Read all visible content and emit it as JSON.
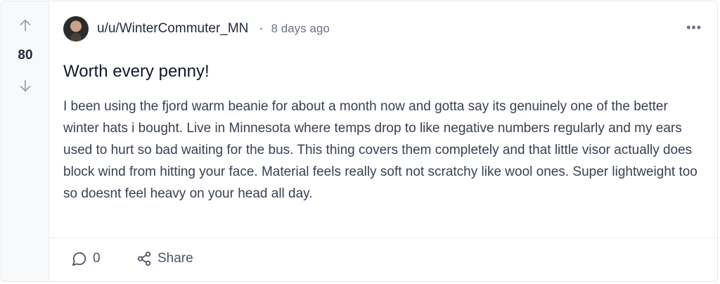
{
  "post": {
    "score": "80",
    "author": "u/u/WinterCommuter_MN",
    "separator": "•",
    "time_ago": "8 days ago",
    "more_label": "•••",
    "title": "Worth every penny!",
    "body": "I been using the fjord warm beanie for about a month now and gotta say its genuinely one of the better winter hats i bought. Live in Minnesota where temps drop to like negative numbers regularly and my ears used to hurt so bad waiting for the bus. This thing covers them completely and that little visor actually does block wind from hitting your face. Material feels really soft not scratchy like wool ones. Super lightweight too so doesnt feel heavy on your head all day."
  },
  "actions": {
    "comment_count": "0",
    "share_label": "Share"
  },
  "icons": {
    "upvote": "arrow-up-icon",
    "downvote": "arrow-down-icon",
    "comment": "comment-bubble-icon",
    "share": "share-icon",
    "more": "more-horizontal-icon"
  }
}
